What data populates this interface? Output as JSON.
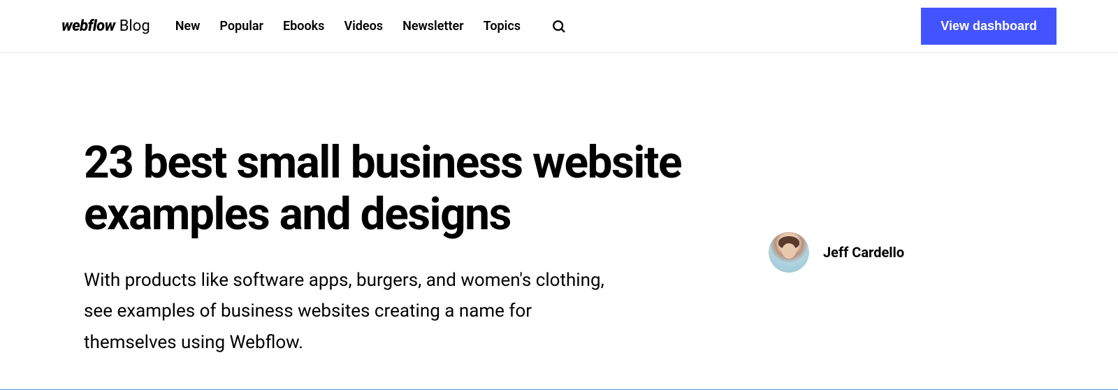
{
  "header": {
    "brand": "webflow",
    "brand_sub": "Blog",
    "nav": {
      "new": "New",
      "popular": "Popular",
      "ebooks": "Ebooks",
      "videos": "Videos",
      "newsletter": "Newsletter",
      "topics": "Topics"
    },
    "cta_label": "View dashboard"
  },
  "article": {
    "title": "23 best small business website examples and designs",
    "subtitle": "With products like software apps, burgers, and women's clothing, see examples of business websites creating a name for themselves using Webflow."
  },
  "author": {
    "name": "Jeff Cardello"
  }
}
